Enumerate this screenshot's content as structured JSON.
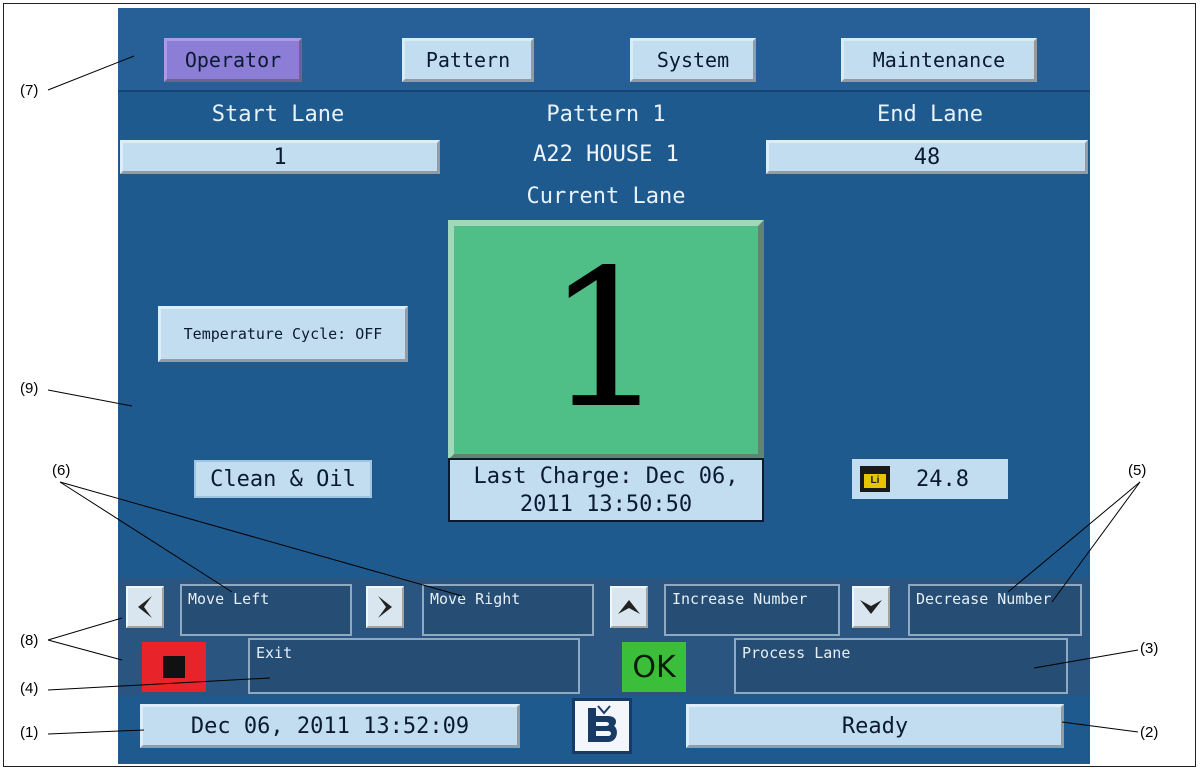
{
  "tabs": [
    "Operator",
    "Pattern",
    "System",
    "Maintenance"
  ],
  "header": {
    "start_lane_label": "Start Lane",
    "pattern_name": "Pattern 1",
    "end_lane_label": "End Lane",
    "start_lane_value": "1",
    "pattern_subtitle": "A22 HOUSE 1",
    "end_lane_value": "48"
  },
  "current": {
    "label": "Current Lane",
    "lane": "1"
  },
  "temperature_cycle": "Temperature Cycle: OFF",
  "mode": "Clean & Oil",
  "last_charge": {
    "line1": "Last Charge: Dec 06,",
    "line2": "2011 13:50:50"
  },
  "battery": {
    "badge": "Li",
    "value": "24.8"
  },
  "controls": {
    "move_left": "Move Left",
    "move_right": "Move Right",
    "increase": "Increase Number",
    "decrease": "Decrease Number",
    "exit": "Exit",
    "ok": "OK",
    "process": "Process Lane"
  },
  "status": {
    "datetime": "Dec 06, 2011 13:52:09",
    "state": "Ready"
  },
  "callouts": [
    "(1)",
    "(2)",
    "(3)",
    "(4)",
    "(5)",
    "(6)",
    "(7)",
    "(8)",
    "(9)"
  ],
  "colors": {
    "screen_bg": "#1f5a8f",
    "lane_green": "#4fbf87",
    "active_tab": "#8c7ed6",
    "stop_red": "#e8232a",
    "ok_green": "#3bbf3b"
  }
}
